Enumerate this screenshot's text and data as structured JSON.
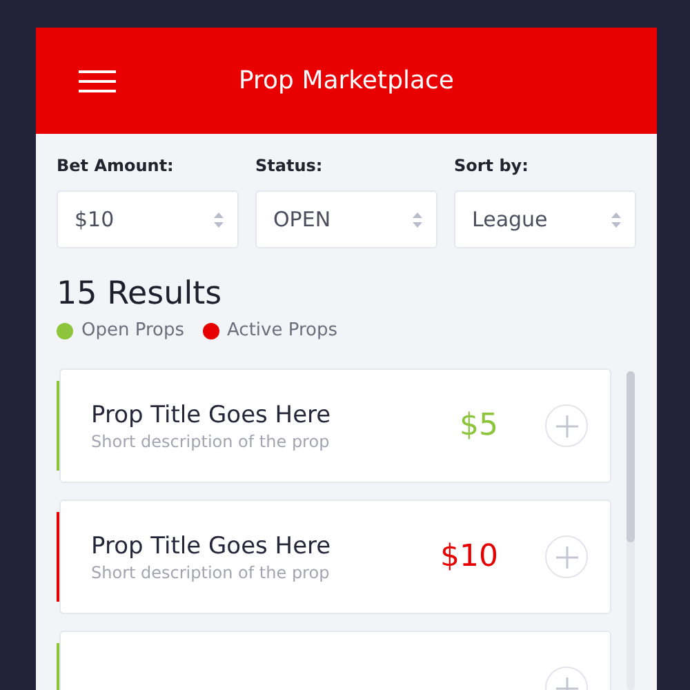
{
  "header": {
    "title": "Prop Marketplace"
  },
  "filters": [
    {
      "label": "Bet Amount:",
      "value": "$10"
    },
    {
      "label": "Status:",
      "value": "OPEN"
    },
    {
      "label": "Sort by:",
      "value": "League"
    }
  ],
  "results": {
    "count": "15 Results"
  },
  "legend": [
    {
      "label": "Open Props",
      "color": "#8cc43c"
    },
    {
      "label": "Active Props",
      "color": "#e60000"
    }
  ],
  "props": [
    {
      "title": "Prop Title Goes Here",
      "description": "Short description of the prop",
      "price": "$5",
      "color": "#8cc43c"
    },
    {
      "title": "Prop Title Goes Here",
      "description": "Short description of the prop",
      "price": "$10",
      "color": "#e60000"
    },
    {
      "color": "#8cc43c"
    }
  ]
}
